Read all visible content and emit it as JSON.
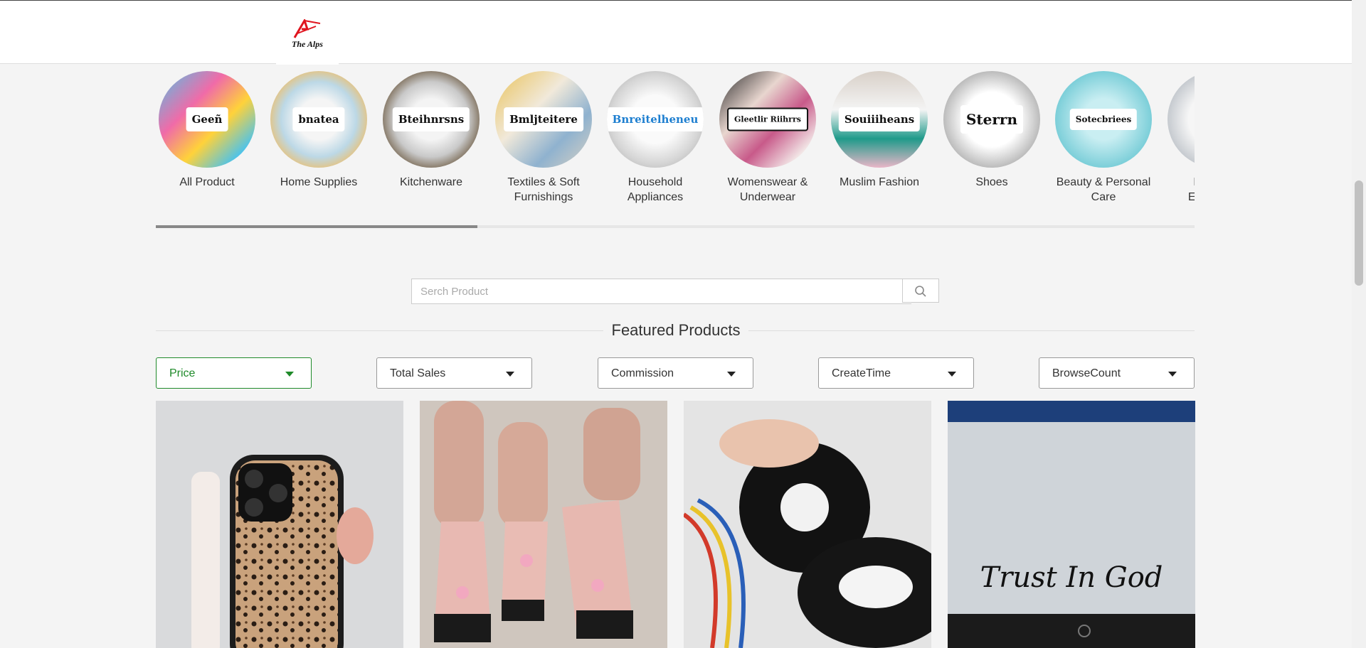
{
  "brand": {
    "logo_text": "The Alps"
  },
  "categories": [
    {
      "label": "All Product",
      "chip": "Geeñ"
    },
    {
      "label": "Home Supplies",
      "chip": "bnatea"
    },
    {
      "label": "Kitchenware",
      "chip": "Bteihnrsns"
    },
    {
      "label": "Textiles & Soft Furnishings",
      "chip": "Bmljteitere"
    },
    {
      "label": "Household Appliances",
      "chip": "Bnreitelheneu"
    },
    {
      "label": "Womenswear & Underwear",
      "chip": "Gleetlir Riihrrs"
    },
    {
      "label": "Muslim Fashion",
      "chip": "Souiiiheans"
    },
    {
      "label": "Shoes",
      "chip": "Sterrn"
    },
    {
      "label": "Beauty & Personal Care",
      "chip": "Sotecbriees"
    },
    {
      "label": "Personal Electronics",
      "chip": ""
    }
  ],
  "search": {
    "placeholder": "Serch Product"
  },
  "section": {
    "title": "Featured Products"
  },
  "filters": [
    {
      "label": "Price",
      "active": true
    },
    {
      "label": "Total Sales",
      "active": false
    },
    {
      "label": "Commission",
      "active": false
    },
    {
      "label": "CreateTime",
      "active": false
    },
    {
      "label": "BrowseCount",
      "active": false
    }
  ],
  "products": [
    {
      "image": "leopard-phone-case-image"
    },
    {
      "image": "press-on-nails-image"
    },
    {
      "image": "black-tape-image"
    },
    {
      "image": "trust-in-god-decal-image",
      "caption": "Trust In God"
    }
  ],
  "colors": {
    "accent": "#1f8a2a",
    "logo_red": "#e0141e"
  }
}
